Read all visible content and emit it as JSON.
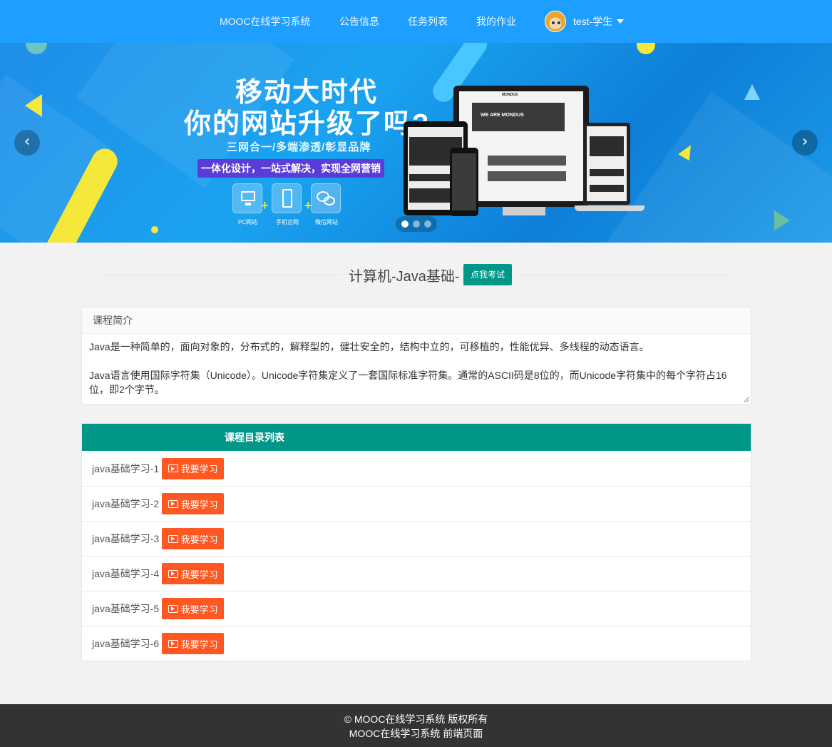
{
  "nav": {
    "items": [
      "MOOC在线学习系统",
      "公告信息",
      "任务列表",
      "我的作业"
    ],
    "user": "test-学生",
    "bg_color": "#1e9fff"
  },
  "banner": {
    "headline_1": "移动大时代",
    "headline_2": "你的网站升级了吗?",
    "subline": "三网合一/多端渗透/彰显品牌",
    "bar_text": "一体化设计，一站式解决，实现全网营销",
    "icons": [
      {
        "icon": "pc-icon",
        "label": "PC网站"
      },
      {
        "icon": "mobile-icon",
        "label": "手机官网"
      },
      {
        "icon": "wechat-icon",
        "label": "微信网站"
      }
    ],
    "device_text": [
      "MONDUS",
      "WE ARE MONDUS"
    ],
    "slide_count": 3,
    "active_slide": 1
  },
  "course": {
    "title": "计算机-Java基础-",
    "exam_button": "点我考试",
    "intro_header": "课程简介",
    "intro_text": "Java是一种简单的，面向对象的，分布式的，解释型的，健壮安全的，结构中立的，可移植的，性能优异、多线程的动态语言。\n\nJava语言使用国际字符集（Unicode）。Unicode字符集定义了一套国际标准字符集。通常的ASCII码是8位的，而Unicode字符集中的每个字符占16位，即2个字节。"
  },
  "catalog": {
    "header": "课程目录列表",
    "study_label": "我要学习",
    "rows": [
      {
        "label": "java基础学习-1"
      },
      {
        "label": "java基础学习-2"
      },
      {
        "label": "java基础学习-3"
      },
      {
        "label": "java基础学习-4"
      },
      {
        "label": "java基础学习-5"
      },
      {
        "label": "java基础学习-6"
      }
    ],
    "header_color": "#009688",
    "button_color": "#ff5722"
  },
  "footer": {
    "line1": "© MOOC在线学习系统 版权所有",
    "line2": "MOOC在线学习系统 前端页面"
  }
}
